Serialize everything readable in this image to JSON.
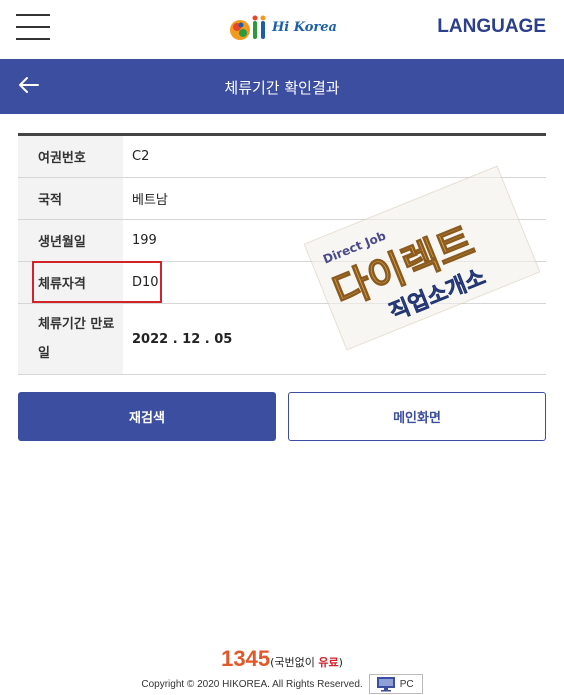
{
  "header": {
    "logo_text": "Hi Korea",
    "language_label": "LANGUAGE"
  },
  "titlebar": {
    "title": "체류기간 확인결과"
  },
  "table": {
    "rows": [
      {
        "label": "여권번호",
        "value": "C2"
      },
      {
        "label": "국적",
        "value": "베트남"
      },
      {
        "label": "생년월일",
        "value": "199"
      },
      {
        "label": "체류자격",
        "value": "D10"
      },
      {
        "label": "체류기간 만료일",
        "value": "2022 . 12 . 05"
      }
    ]
  },
  "buttons": {
    "research": "재검색",
    "main": "메인화면"
  },
  "watermark": {
    "line1": "Direct Job",
    "line2": "다이렉트",
    "line3": "직업소개소"
  },
  "footer": {
    "call_number": "1345",
    "call_prefix": "(국번없이 ",
    "call_free": "유료",
    "call_suffix": ")",
    "copyright": "Copyright © 2020 HIKOREA. All Rights Reserved.",
    "pc_label": "PC"
  },
  "colors": {
    "brand": "#3c4ea0",
    "highlight": "#d3232a",
    "accent": "#e2582a"
  }
}
